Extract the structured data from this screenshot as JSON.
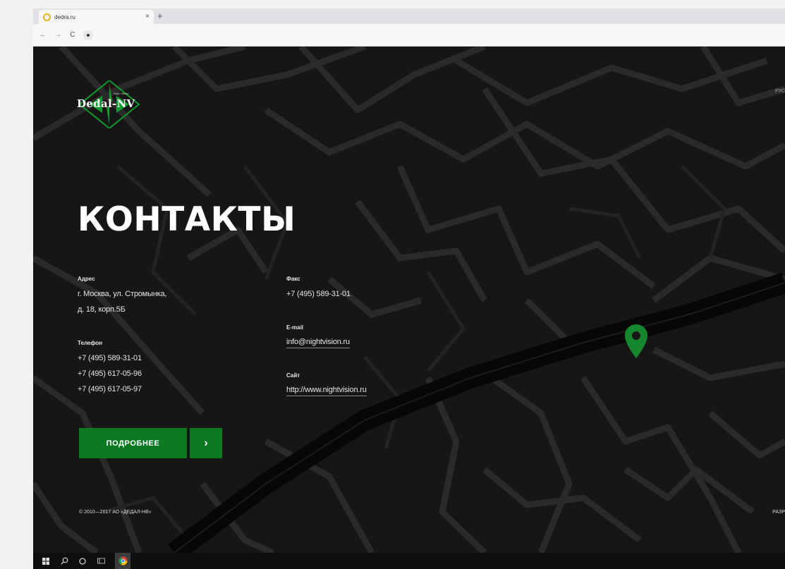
{
  "browser": {
    "tab_title": "dedra.ru",
    "tab_close": "×",
    "new_tab": "+"
  },
  "toolbar": {
    "back": "←",
    "forward": "→",
    "reload": "C"
  },
  "header": {
    "logo_text": "Dedal-NV",
    "logo_tagline": "Night Vision",
    "lang": "РУС"
  },
  "page": {
    "title": "КОНТАКТЫ"
  },
  "contacts": {
    "address_label": "Адрес",
    "address_line1": "г. Москва, ул. Стромынка,",
    "address_line2": "д. 18, корп.5Б",
    "phone_label": "Телефон",
    "phones": [
      "+7 (495) 589-31-01",
      "+7 (495) 617-05-96",
      "+7 (495) 617-05-97"
    ],
    "fax_label": "Факс",
    "fax": "+7 (495) 589-31-01",
    "email_label": "E-mail",
    "email": "info@nightvision.ru",
    "site_label": "Сайт",
    "site": "http://www.nightvision.ru"
  },
  "actions": {
    "more_label": "ПОДРОБНЕЕ",
    "arrow_label": "›"
  },
  "footer": {
    "copyright": "© 2010—2017 АО «ДЕДАЛ-НВ»",
    "dev": "РАЗР"
  },
  "colors": {
    "accent": "#0b7a23",
    "pin": "#17872f",
    "background": "#161616"
  },
  "icons": {
    "favicon": "globe-icon",
    "pin": "map-pin-icon",
    "windows": "windows-icon",
    "search": "search-icon",
    "cortana": "circle-icon",
    "task_view": "task-view-icon",
    "chrome": "chrome-icon"
  }
}
